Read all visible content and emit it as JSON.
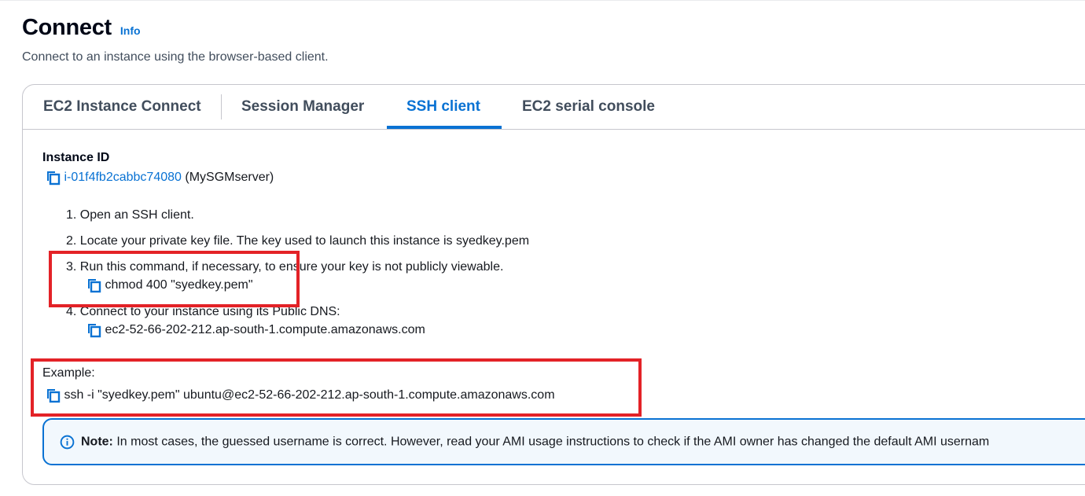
{
  "header": {
    "title": "Connect",
    "info_link": "Info",
    "description": "Connect to an instance using the browser-based client."
  },
  "tabs": [
    {
      "label": "EC2 Instance Connect",
      "active": false
    },
    {
      "label": "Session Manager",
      "active": false
    },
    {
      "label": "SSH client",
      "active": true
    },
    {
      "label": "EC2 serial console",
      "active": false
    }
  ],
  "instance": {
    "label": "Instance ID",
    "id": "i-01f4fb2cabbc74080",
    "name": "(MySGMserver)"
  },
  "steps": [
    {
      "text": "1. Open an SSH client."
    },
    {
      "text": "2. Locate your private key file. The key used to launch this instance is syedkey.pem"
    },
    {
      "text": "3. Run this command, if necessary, to ensure your key is not publicly viewable.",
      "command": "chmod 400 \"syedkey.pem\""
    },
    {
      "text": "4. Connect to your instance using its Public DNS:",
      "command": "ec2-52-66-202-212.ap-south-1.compute.amazonaws.com"
    }
  ],
  "example": {
    "label": "Example:",
    "command": "ssh -i \"syedkey.pem\" ubuntu@ec2-52-66-202-212.ap-south-1.compute.amazonaws.com"
  },
  "note": {
    "label": "Note:",
    "text": " In most cases, the guessed username is correct. However, read your AMI usage instructions to check if the AMI owner has changed the default AMI usernam"
  },
  "colors": {
    "accent": "#0972d3",
    "highlight": "#e32227"
  },
  "icons": {
    "copy": "copy-icon",
    "info": "info-circle-icon"
  }
}
